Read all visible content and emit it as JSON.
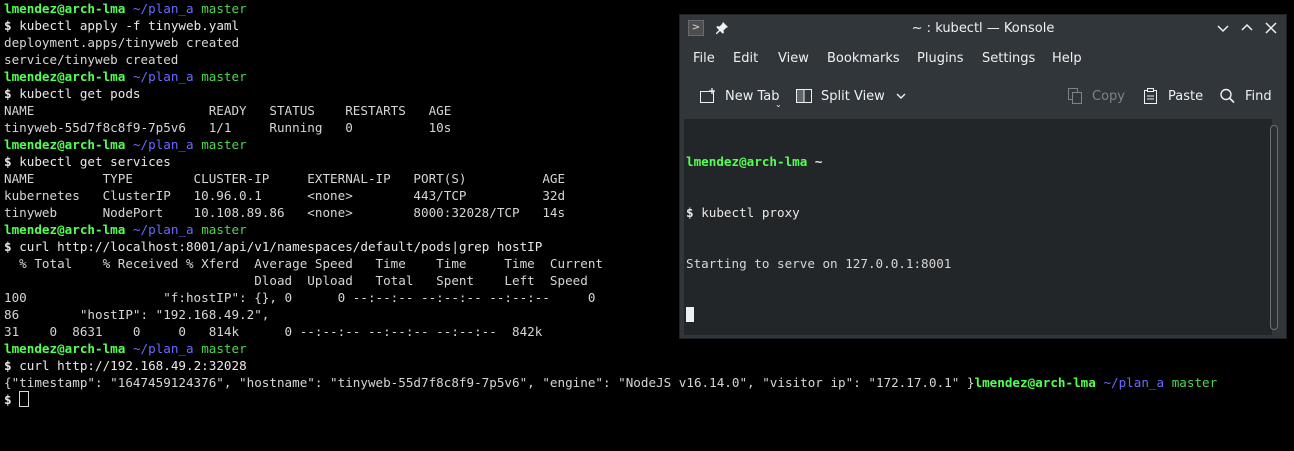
{
  "terminal": {
    "lines": [
      {
        "type": "prompt",
        "user": "lmendez@arch-lma",
        "path": "~/plan_a",
        "branch": "master"
      },
      {
        "type": "cmd",
        "text": "kubectl apply -f tinyweb.yaml"
      },
      {
        "type": "out",
        "text": "deployment.apps/tinyweb created"
      },
      {
        "type": "out",
        "text": "service/tinyweb created"
      },
      {
        "type": "prompt",
        "user": "lmendez@arch-lma",
        "path": "~/plan_a",
        "branch": "master"
      },
      {
        "type": "cmd",
        "text": "kubectl get pods"
      },
      {
        "type": "out",
        "text": "NAME                       READY   STATUS    RESTARTS   AGE"
      },
      {
        "type": "out",
        "text": "tinyweb-55d7f8c8f9-7p5v6   1/1     Running   0          10s"
      },
      {
        "type": "prompt",
        "user": "lmendez@arch-lma",
        "path": "~/plan_a",
        "branch": "master"
      },
      {
        "type": "cmd",
        "text": "kubectl get services"
      },
      {
        "type": "out",
        "text": "NAME         TYPE        CLUSTER-IP     EXTERNAL-IP   PORT(S)          AGE"
      },
      {
        "type": "out",
        "text": "kubernetes   ClusterIP   10.96.0.1      <none>        443/TCP          32d"
      },
      {
        "type": "out",
        "text": "tinyweb      NodePort    10.108.89.86   <none>        8000:32028/TCP   14s"
      },
      {
        "type": "prompt",
        "user": "lmendez@arch-lma",
        "path": "~/plan_a",
        "branch": "master"
      },
      {
        "type": "cmd",
        "text": "curl http://localhost:8001/api/v1/namespaces/default/pods|grep hostIP"
      },
      {
        "type": "out",
        "text": "  % Total    % Received % Xferd  Average Speed   Time    Time     Time  Current"
      },
      {
        "type": "out",
        "text": "                                 Dload  Upload   Total   Spent    Left  Speed"
      },
      {
        "type": "out",
        "text": "100                  \"f:hostIP\": {}, 0      0 --:--:-- --:--:-- --:--:--     0"
      },
      {
        "type": "out",
        "text": "86        \"hostIP\": \"192.168.49.2\","
      },
      {
        "type": "out",
        "text": "31    0  8631    0     0   814k      0 --:--:-- --:--:-- --:--:--  842k"
      },
      {
        "type": "prompt",
        "user": "lmendez@arch-lma",
        "path": "~/plan_a",
        "branch": "master"
      },
      {
        "type": "cmd",
        "text": "curl http://192.168.49.2:32028"
      },
      {
        "type": "mixed",
        "text": "{\"timestamp\": \"1647459124376\", \"hostname\": \"tinyweb-55d7f8c8f9-7p5v6\", \"engine\": \"NodeJS v16.14.0\", \"visitor ip\": \"172.17.0.1\" }",
        "user": "lmendez@arch-lma",
        "path": "~/plan_a",
        "branch": "master"
      },
      {
        "type": "cursor"
      }
    ],
    "prompt_symbol": "$"
  },
  "konsole": {
    "title": "~ : kubectl — Konsole",
    "menu": [
      "File",
      "Edit",
      "View",
      "Bookmarks",
      "Plugins",
      "Settings",
      "Help"
    ],
    "toolbar": {
      "new_tab": "New Tab",
      "split_view": "Split View",
      "copy": "Copy",
      "paste": "Paste",
      "find": "Find"
    },
    "session": {
      "user": "lmendez@arch-lma",
      "path": "~",
      "prompt_symbol": "$",
      "command": "kubectl proxy",
      "output": "Starting to serve on 127.0.0.1:8001"
    }
  },
  "colors": {
    "prompt_user": "#54ff54",
    "prompt_path": "#6a6aff",
    "prompt_branch": "#4fd64f",
    "window_bg": "#31363b",
    "terminal_bg": "#232629"
  }
}
